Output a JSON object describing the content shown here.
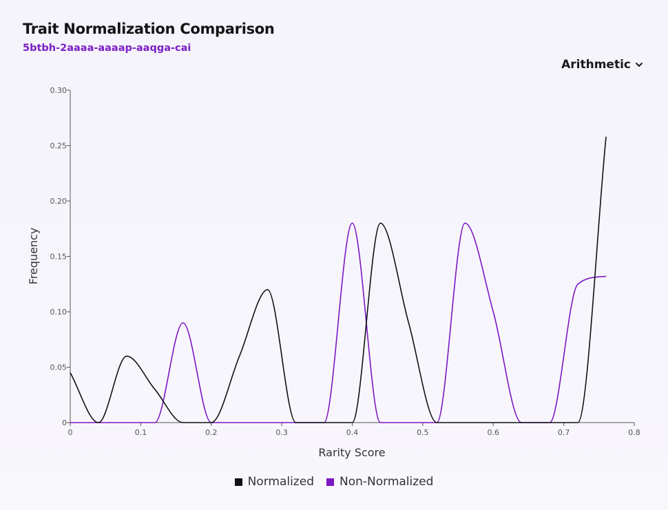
{
  "header": {
    "title": "Trait Normalization Comparison",
    "canister_id": "5btbh-2aaaa-aaaap-aaqga-cai"
  },
  "controls": {
    "mean_select_value": "Arithmetic",
    "chevron_icon": "chevron-down-icon"
  },
  "colors": {
    "normalized": "#111111",
    "non_normalized": "#7a16c2",
    "axis": "#555555"
  },
  "chart_data": {
    "type": "line",
    "xlabel": "Rarity Score",
    "ylabel": "Frequency",
    "xlim": [
      0,
      0.8
    ],
    "ylim": [
      0,
      0.3
    ],
    "xticks": [
      0,
      0.1,
      0.2,
      0.3,
      0.4,
      0.5,
      0.6,
      0.7,
      0.8
    ],
    "xtick_labels": [
      "0",
      "0.1",
      "0.2",
      "0.3",
      "0.4",
      "0.5",
      "0.6",
      "0.7",
      "0.8"
    ],
    "yticks": [
      0,
      0.05,
      0.1,
      0.15,
      0.2,
      0.25,
      0.3
    ],
    "ytick_labels": [
      "0",
      "0.05",
      "0.10",
      "0.15",
      "0.20",
      "0.25",
      "0.30"
    ],
    "grid": false,
    "legend_position": "bottom-center",
    "series": [
      {
        "name": "Normalized",
        "color": "#111111",
        "points": [
          [
            0,
            0.045
          ],
          [
            0.04,
            0
          ],
          [
            0.08,
            0.06
          ],
          [
            0.12,
            0.03
          ],
          [
            0.16,
            0
          ],
          [
            0.2,
            0
          ],
          [
            0.24,
            0.06
          ],
          [
            0.28,
            0.12
          ],
          [
            0.32,
            0
          ],
          [
            0.36,
            0
          ],
          [
            0.4,
            0
          ],
          [
            0.44,
            0.18
          ],
          [
            0.48,
            0.09
          ],
          [
            0.52,
            0
          ],
          [
            0.56,
            0
          ],
          [
            0.6,
            0
          ],
          [
            0.64,
            0
          ],
          [
            0.68,
            0
          ],
          [
            0.72,
            0
          ],
          [
            0.76,
            0.258
          ]
        ]
      },
      {
        "name": "Non-Normalized",
        "color": "#7a16c2",
        "points": [
          [
            0,
            0
          ],
          [
            0.04,
            0
          ],
          [
            0.08,
            0
          ],
          [
            0.12,
            0
          ],
          [
            0.16,
            0.09
          ],
          [
            0.2,
            0
          ],
          [
            0.24,
            0
          ],
          [
            0.28,
            0
          ],
          [
            0.32,
            0
          ],
          [
            0.36,
            0
          ],
          [
            0.4,
            0.18
          ],
          [
            0.44,
            0
          ],
          [
            0.48,
            0
          ],
          [
            0.52,
            0
          ],
          [
            0.56,
            0.18
          ],
          [
            0.6,
            0.1
          ],
          [
            0.64,
            0
          ],
          [
            0.68,
            0
          ],
          [
            0.72,
            0.125
          ],
          [
            0.76,
            0.132
          ]
        ]
      }
    ]
  }
}
